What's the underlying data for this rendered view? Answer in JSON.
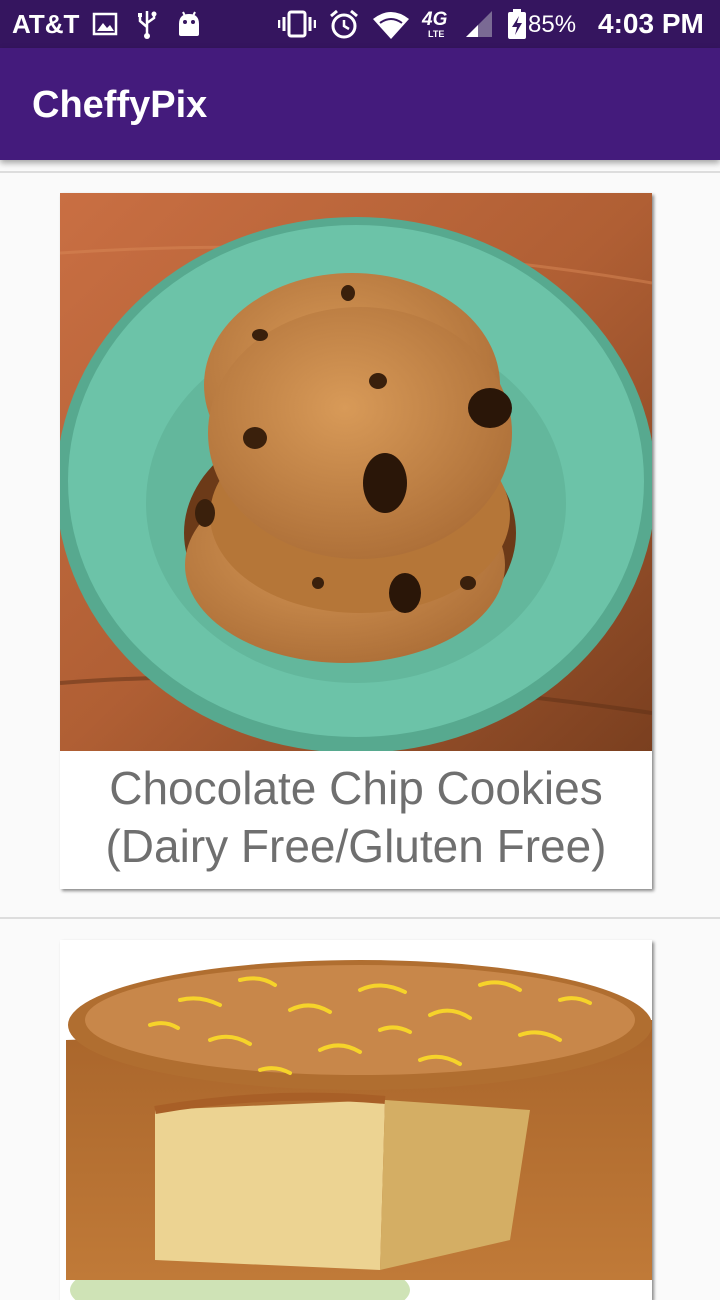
{
  "status_bar": {
    "carrier": "AT&T",
    "network_label": "4G",
    "network_sub": "LTE",
    "battery_percent": "85%",
    "time": "4:03 PM",
    "icons": [
      "image-icon",
      "usb-icon",
      "android-icon",
      "vibrate-icon",
      "alarm-icon",
      "wifi-icon",
      "signal-icon",
      "battery-charging-icon"
    ]
  },
  "app_bar": {
    "title": "CheffyPix"
  },
  "recipes": [
    {
      "title_line1": "Chocolate Chip Cookies",
      "title_line2": "(Dairy Free/Gluten Free)",
      "image": "chocolate-chip-cookies-photo"
    },
    {
      "image": "lemon-cake-photo"
    }
  ],
  "colors": {
    "status_bar": "#35155f",
    "app_bar": "#441b7c",
    "background": "#fafafa",
    "plate": "#6cc3a8",
    "title_text": "#6f6f6f"
  }
}
